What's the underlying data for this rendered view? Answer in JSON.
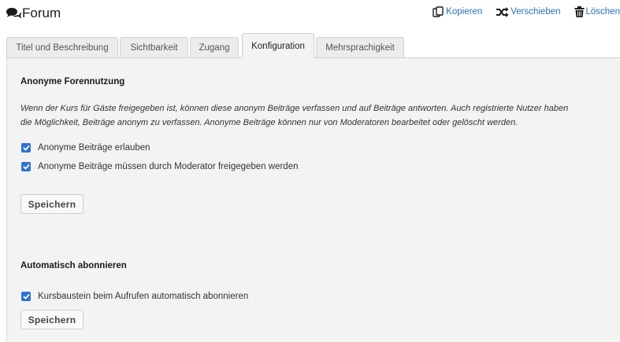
{
  "header": {
    "title": "Forum",
    "actions": {
      "copy": "Kopieren",
      "move": "Verschieben",
      "delete": "Löschen"
    }
  },
  "tabs": [
    {
      "label": "Titel und Beschreibung",
      "active": false
    },
    {
      "label": "Sichtbarkeit",
      "active": false
    },
    {
      "label": "Zugang",
      "active": false
    },
    {
      "label": "Konfiguration",
      "active": true
    },
    {
      "label": "Mehrsprachigkeit",
      "active": false
    }
  ],
  "anonymous": {
    "heading": "Anonyme Forennutzung",
    "description_line1": "Wenn der Kurs für Gäste freigegeben ist, können diese anonym Beiträge verfassen und auf Beiträge antworten. Auch registrierte Nutzer haben",
    "description_line2": "die Möglichkeit, Beiträge anonym zu verfassen. Anonyme Beiträge können nur von Moderatoren bearbeitet oder gelöscht werden.",
    "options": [
      {
        "label": "Anonyme Beiträge erlauben",
        "checked": true
      },
      {
        "label": "Anonyme Beiträge müssen durch Moderator freigegeben werden",
        "checked": true
      }
    ],
    "save_label": "Speichern"
  },
  "autosubscribe": {
    "heading": "Automatisch abonnieren",
    "options": [
      {
        "label": "Kursbaustein beim Aufrufen automatisch abonnieren",
        "checked": true
      }
    ],
    "save_label": "Speichern"
  },
  "colors": {
    "accent": "#2f73d0",
    "link": "#2a6ebb",
    "panel": "#f3f3f3"
  },
  "icons": {
    "title": "forum-chat-icon",
    "copy": "copy-icon",
    "move": "shuffle-icon",
    "delete": "trash-icon",
    "checkbox": "checkmark-icon"
  }
}
